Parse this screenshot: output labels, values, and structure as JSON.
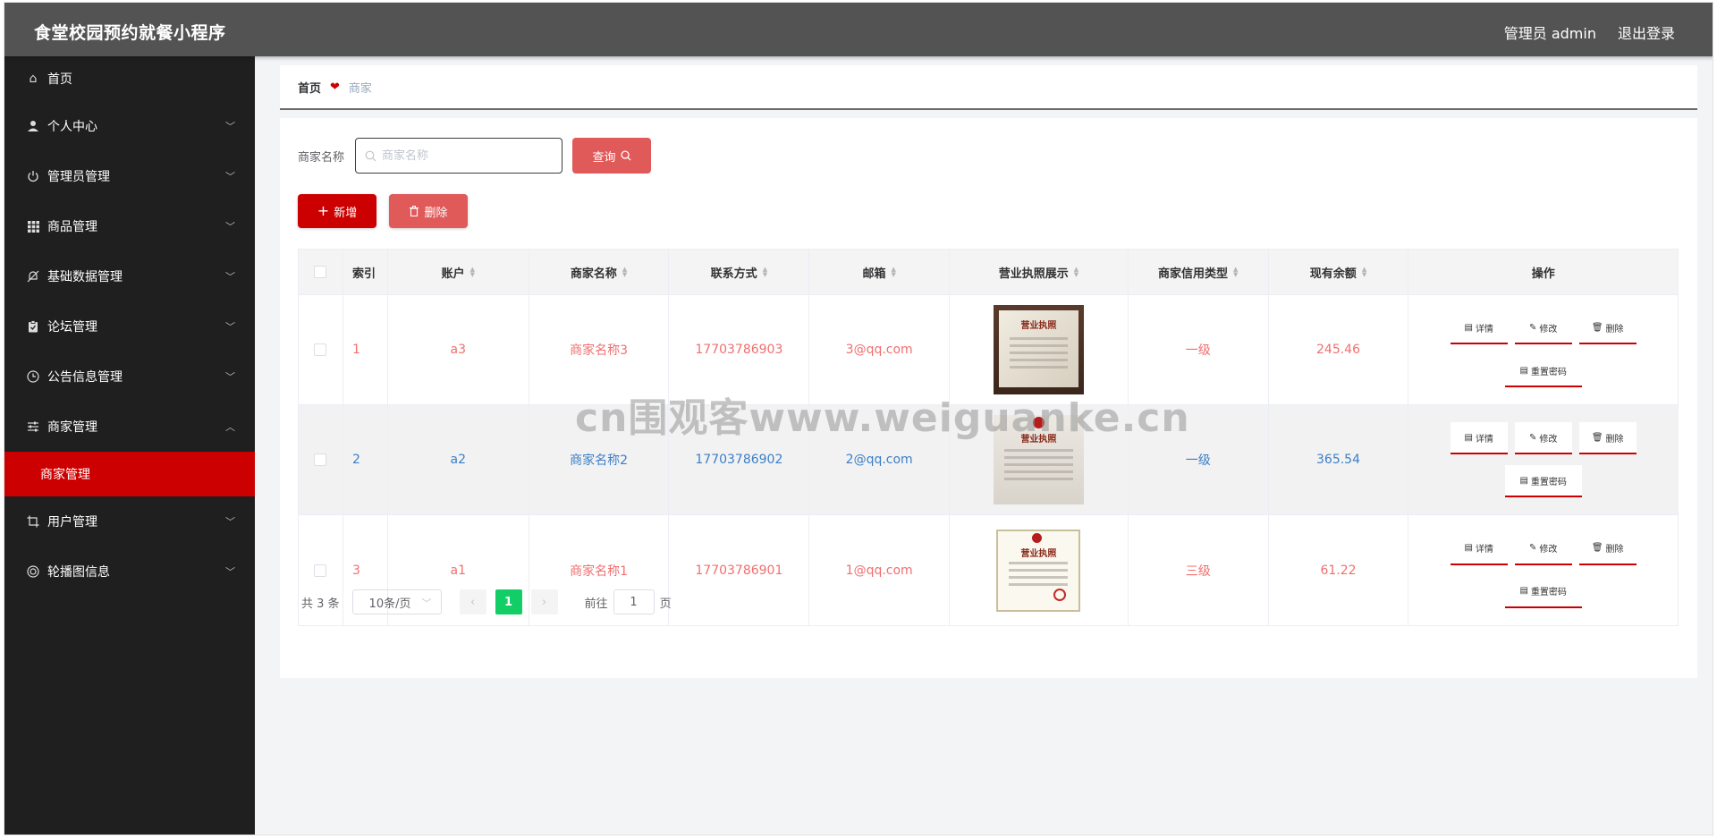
{
  "header": {
    "title": "食堂校园预约就餐小程序",
    "user_label": "管理员 admin",
    "logout_label": "退出登录"
  },
  "sidebar": {
    "items": [
      {
        "label": "首页",
        "icon": "home-icon"
      },
      {
        "label": "个人中心",
        "icon": "user-icon"
      },
      {
        "label": "管理员管理",
        "icon": "power-icon"
      },
      {
        "label": "商品管理",
        "icon": "grid-icon"
      },
      {
        "label": "基础数据管理",
        "icon": "bell-off-icon"
      },
      {
        "label": "论坛管理",
        "icon": "clipboard-icon"
      },
      {
        "label": "公告信息管理",
        "icon": "clock-icon"
      },
      {
        "label": "商家管理",
        "icon": "sliders-icon"
      },
      {
        "label": "用户管理",
        "icon": "crop-icon"
      },
      {
        "label": "轮播图信息",
        "icon": "circle-icon"
      }
    ],
    "active_sub": "商家管理"
  },
  "breadcrumb": {
    "home": "首页",
    "current": "商家"
  },
  "search": {
    "label": "商家名称",
    "placeholder": "商家名称",
    "query_label": "查询"
  },
  "actions": {
    "add_label": "新增",
    "delete_label": "删除"
  },
  "table": {
    "headers": {
      "index": "索引",
      "account": "账户",
      "name": "商家名称",
      "phone": "联系方式",
      "email": "邮箱",
      "license": "营业执照展示",
      "credit": "商家信用类型",
      "balance": "现有余额",
      "ops": "操作"
    },
    "rows": [
      {
        "index": "1",
        "account": "a3",
        "name": "商家名称3",
        "phone": "17703786903",
        "email": "3@qq.com",
        "credit": "一级",
        "balance": "245.46"
      },
      {
        "index": "2",
        "account": "a2",
        "name": "商家名称2",
        "phone": "17703786902",
        "email": "2@qq.com",
        "credit": "一级",
        "balance": "365.54"
      },
      {
        "index": "3",
        "account": "a1",
        "name": "商家名称1",
        "phone": "17703786901",
        "email": "1@qq.com",
        "credit": "三级",
        "balance": "61.22"
      }
    ],
    "op_labels": {
      "detail": "详情",
      "edit": "修改",
      "delete": "删除",
      "reset": "重置密码"
    },
    "license_titles": [
      "营业执照",
      "营业执照",
      "营业执照"
    ]
  },
  "pagination": {
    "total": "共 3 条",
    "page_size": "10条/页",
    "current_page": "1",
    "goto_prefix": "前往",
    "goto_value": "1",
    "goto_suffix": "页"
  },
  "watermark": "cn围观客www.weiguanke.cn",
  "colors": {
    "header_bg": "#535353",
    "sidebar_bg": "#1f1f1f",
    "accent_red": "#cc0000",
    "soft_red": "#e05a5a",
    "row_red_text": "#f06f6f",
    "row_blue_text": "#3c7fc6",
    "page_active": "#13ce66"
  }
}
